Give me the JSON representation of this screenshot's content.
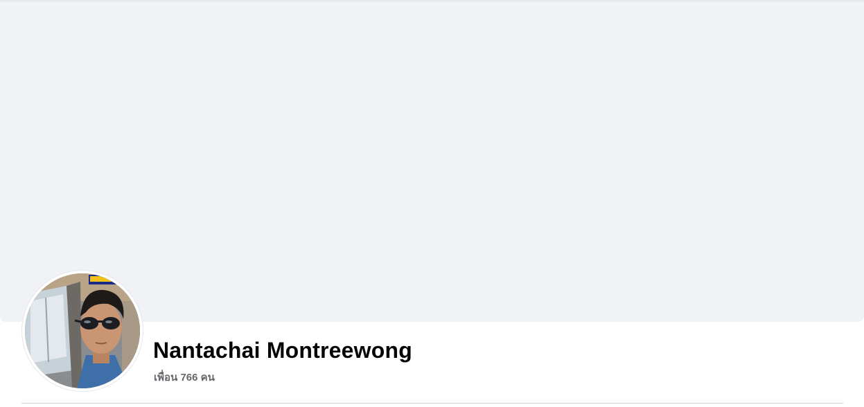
{
  "profile": {
    "name": "Nantachai Montreewong",
    "friends_text": "เพื่อน 766 คน",
    "avatar_alt": "profile-photo"
  },
  "colors": {
    "cover_bg": "#f0f2f5",
    "name_text": "#050505",
    "secondary_text": "#65676b",
    "divider": "#ced0d4"
  }
}
